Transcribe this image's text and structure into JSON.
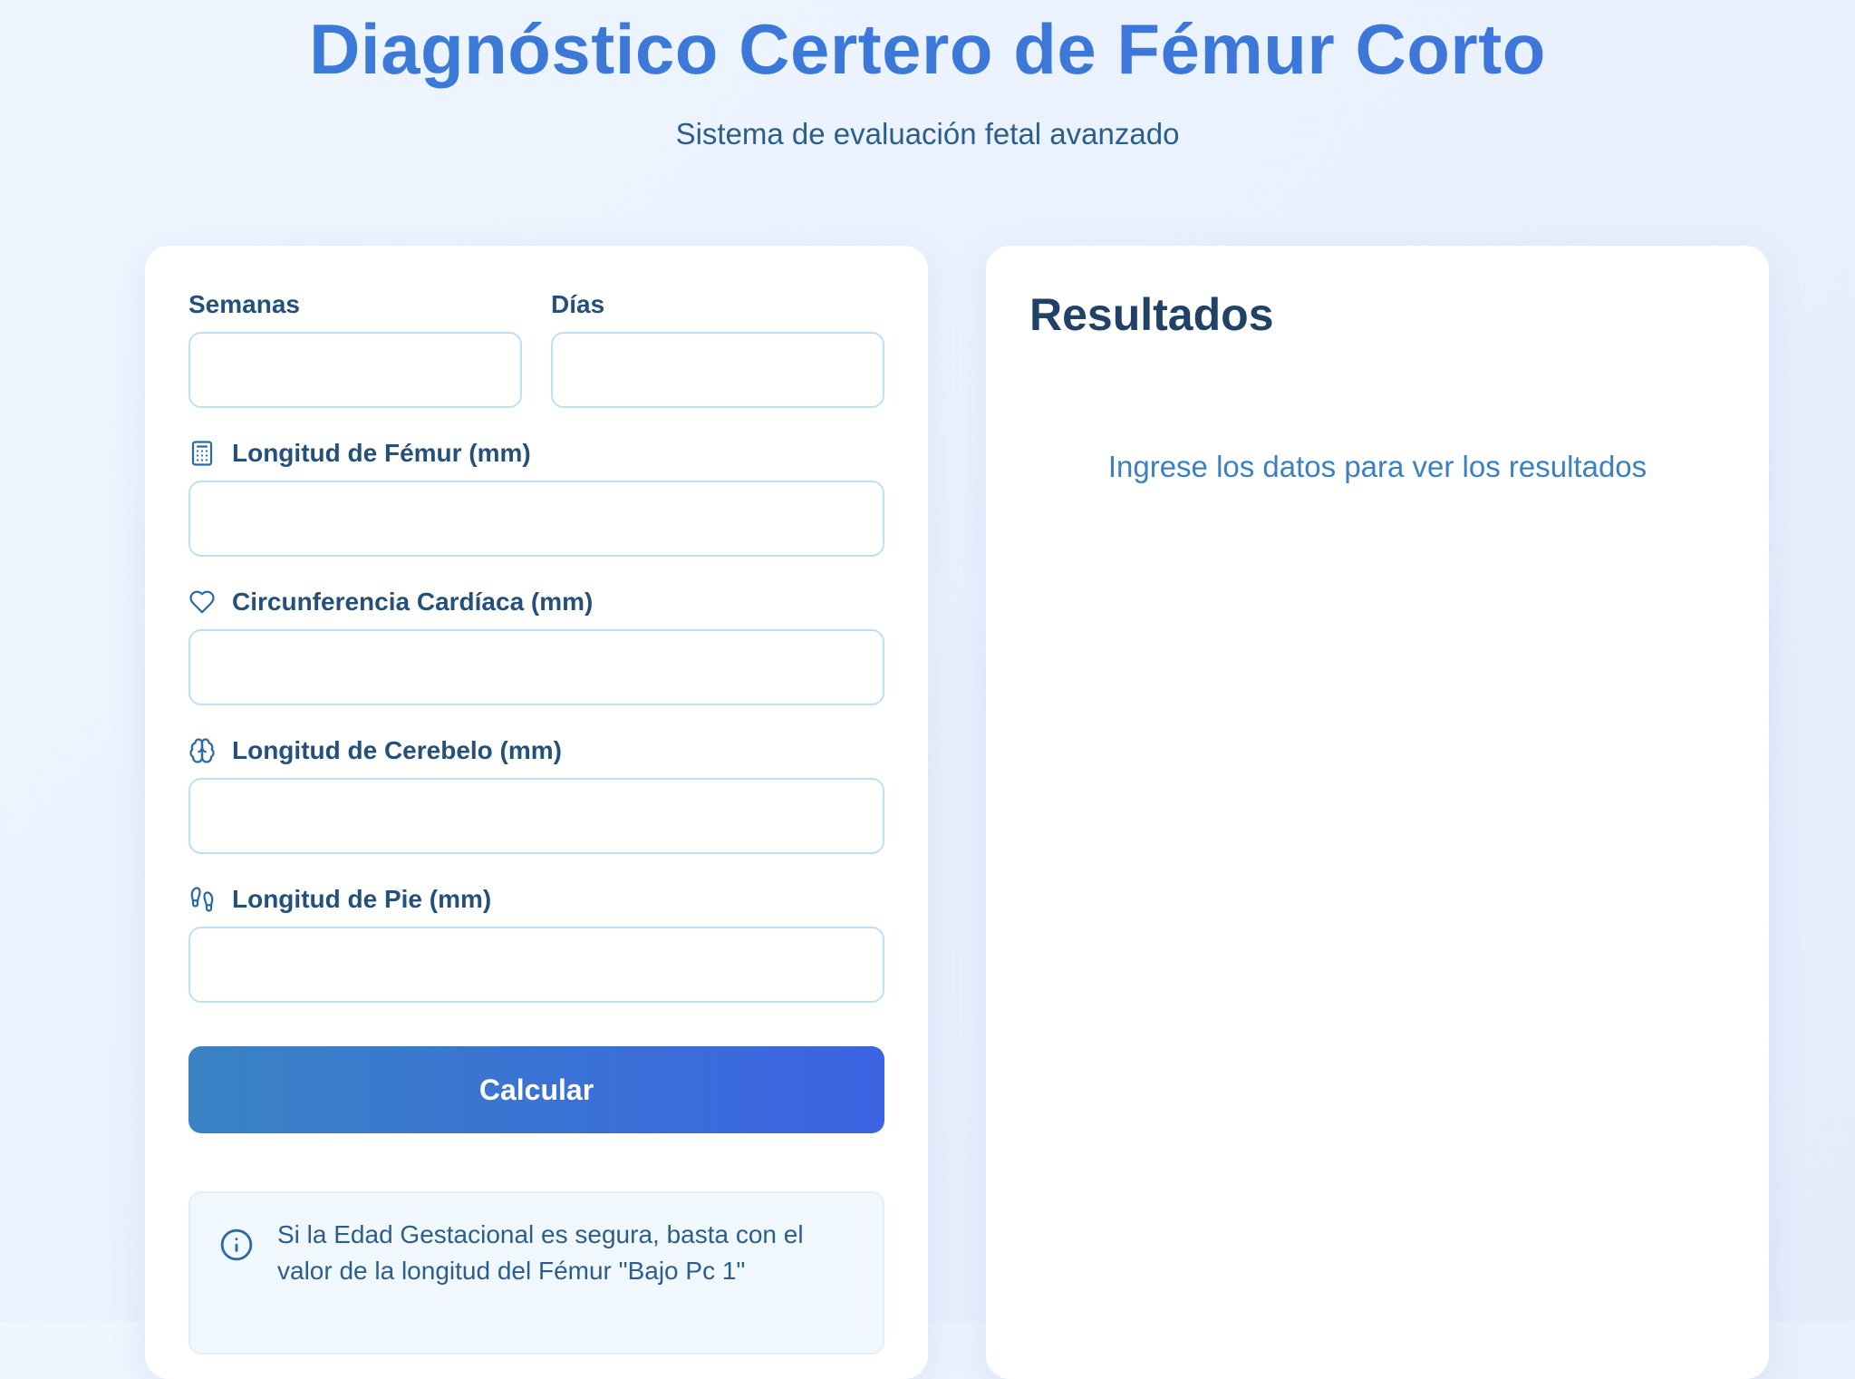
{
  "header": {
    "title": "Diagnóstico Certero de Fémur Corto",
    "subtitle": "Sistema de evaluación fetal avanzado"
  },
  "form": {
    "weeks_label": "Semanas",
    "weeks_value": "",
    "days_label": "Días",
    "days_value": "",
    "femur": {
      "label": "Longitud de Fémur (mm)",
      "icon": "calculator-icon",
      "value": ""
    },
    "heart": {
      "label": "Circunferencia Cardíaca (mm)",
      "icon": "heart-icon",
      "value": ""
    },
    "cerebellum": {
      "label": "Longitud de Cerebelo (mm)",
      "icon": "brain-icon",
      "value": ""
    },
    "foot": {
      "label": "Longitud de Pie (mm)",
      "icon": "footprints-icon",
      "value": ""
    },
    "calculate_label": "Calcular",
    "info_icon": "info-icon",
    "info_text": "Si la Edad Gestacional es segura, basta con el valor de la longitud del Fémur \"Bajo Pc 1\""
  },
  "results": {
    "title": "Resultados",
    "empty_message": "Ingrese los datos para ver los resultados"
  },
  "colors": {
    "accent": "#3a7bd5",
    "button_start": "#3a83c4",
    "button_end": "#3b63e3",
    "text_dark": "#1f4266",
    "label": "#245079",
    "input_border": "#bde0f0"
  }
}
